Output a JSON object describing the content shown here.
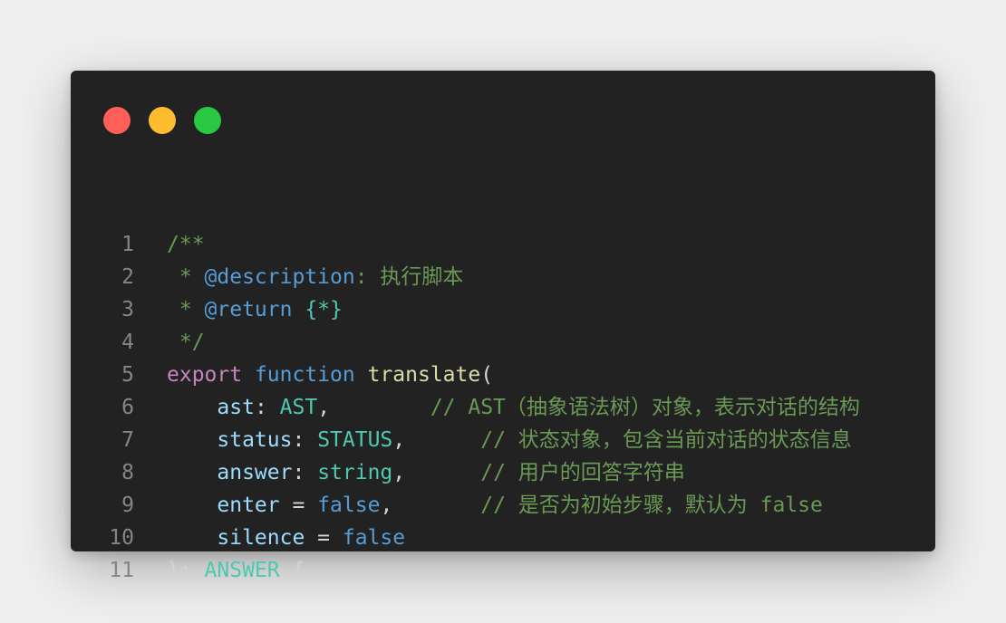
{
  "colors": {
    "page_background": "#efefef",
    "editor_background": "#222222",
    "close_dot": "#ff5f57",
    "minimize_dot": "#febc2e",
    "maximize_dot": "#28c840"
  },
  "lines": [
    {
      "num": "1",
      "tokens": [
        {
          "t": "/**",
          "c": "com"
        }
      ]
    },
    {
      "num": "2",
      "tokens": [
        {
          "t": " * ",
          "c": "com"
        },
        {
          "t": "@description",
          "c": "tag"
        },
        {
          "t": ": 执行脚本",
          "c": "com"
        }
      ]
    },
    {
      "num": "3",
      "tokens": [
        {
          "t": " * ",
          "c": "com"
        },
        {
          "t": "@return",
          "c": "tag"
        },
        {
          "t": " ",
          "c": "com"
        },
        {
          "t": "{*}",
          "c": "typ"
        }
      ]
    },
    {
      "num": "4",
      "tokens": [
        {
          "t": " */",
          "c": "com"
        }
      ]
    },
    {
      "num": "5",
      "tokens": [
        {
          "t": "export",
          "c": "kw"
        },
        {
          "t": " ",
          "c": "pl"
        },
        {
          "t": "function",
          "c": "sto"
        },
        {
          "t": " ",
          "c": "pl"
        },
        {
          "t": "translate",
          "c": "fn"
        },
        {
          "t": "(",
          "c": "pun"
        }
      ]
    },
    {
      "num": "6",
      "tokens": [
        {
          "t": "    ",
          "c": "pl"
        },
        {
          "t": "ast",
          "c": "prm"
        },
        {
          "t": ": ",
          "c": "pun"
        },
        {
          "t": "AST",
          "c": "typ"
        },
        {
          "t": ",        ",
          "c": "pun"
        },
        {
          "t": "// AST（抽象语法树）对象，表示对话的结构",
          "c": "com"
        }
      ]
    },
    {
      "num": "7",
      "tokens": [
        {
          "t": "    ",
          "c": "pl"
        },
        {
          "t": "status",
          "c": "prm"
        },
        {
          "t": ": ",
          "c": "pun"
        },
        {
          "t": "STATUS",
          "c": "typ"
        },
        {
          "t": ",      ",
          "c": "pun"
        },
        {
          "t": "// 状态对象，包含当前对话的状态信息",
          "c": "com"
        }
      ]
    },
    {
      "num": "8",
      "tokens": [
        {
          "t": "    ",
          "c": "pl"
        },
        {
          "t": "answer",
          "c": "prm"
        },
        {
          "t": ": ",
          "c": "pun"
        },
        {
          "t": "string",
          "c": "typ"
        },
        {
          "t": ",      ",
          "c": "pun"
        },
        {
          "t": "// 用户的回答字符串",
          "c": "com"
        }
      ]
    },
    {
      "num": "9",
      "tokens": [
        {
          "t": "    ",
          "c": "pl"
        },
        {
          "t": "enter",
          "c": "prm"
        },
        {
          "t": " = ",
          "c": "pun"
        },
        {
          "t": "false",
          "c": "bool"
        },
        {
          "t": ",       ",
          "c": "pun"
        },
        {
          "t": "// 是否为初始步骤，默认为 false",
          "c": "com"
        }
      ]
    },
    {
      "num": "10",
      "tokens": [
        {
          "t": "    ",
          "c": "pl"
        },
        {
          "t": "silence",
          "c": "prm"
        },
        {
          "t": " = ",
          "c": "pun"
        },
        {
          "t": "false",
          "c": "bool"
        }
      ]
    },
    {
      "num": "11",
      "tokens": [
        {
          "t": "): ",
          "c": "pun"
        },
        {
          "t": "ANSWER",
          "c": "typ"
        },
        {
          "t": " {",
          "c": "pun"
        }
      ]
    }
  ]
}
